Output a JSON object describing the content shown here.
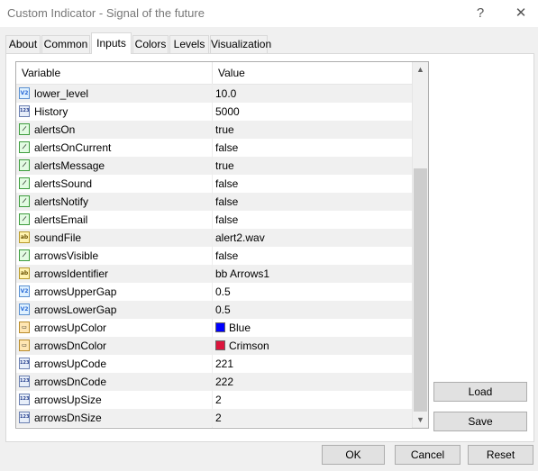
{
  "window": {
    "title": "Custom Indicator - Signal of the future",
    "help_glyph": "?",
    "close_glyph": "✕"
  },
  "tabs": [
    {
      "label": "About"
    },
    {
      "label": "Common"
    },
    {
      "label": "Inputs"
    },
    {
      "label": "Colors"
    },
    {
      "label": "Levels"
    },
    {
      "label": "Visualization"
    }
  ],
  "active_tab": "Inputs",
  "grid": {
    "columns": {
      "variable": "Variable",
      "value": "Value"
    },
    "rows": [
      {
        "type": "double",
        "name": "lower_level",
        "value": "10.0"
      },
      {
        "type": "int",
        "name": "History",
        "value": "5000"
      },
      {
        "type": "bool",
        "name": "alertsOn",
        "value": "true"
      },
      {
        "type": "bool",
        "name": "alertsOnCurrent",
        "value": "false"
      },
      {
        "type": "bool",
        "name": "alertsMessage",
        "value": "true"
      },
      {
        "type": "bool",
        "name": "alertsSound",
        "value": "false"
      },
      {
        "type": "bool",
        "name": "alertsNotify",
        "value": "false"
      },
      {
        "type": "bool",
        "name": "alertsEmail",
        "value": "false"
      },
      {
        "type": "string",
        "name": "soundFile",
        "value": "alert2.wav"
      },
      {
        "type": "bool",
        "name": "arrowsVisible",
        "value": "false"
      },
      {
        "type": "string",
        "name": "arrowsIdentifier",
        "value": "bb Arrows1"
      },
      {
        "type": "double",
        "name": "arrowsUpperGap",
        "value": "0.5"
      },
      {
        "type": "double",
        "name": "arrowsLowerGap",
        "value": "0.5"
      },
      {
        "type": "color",
        "name": "arrowsUpColor",
        "value": "Blue",
        "swatch": "#0000ff"
      },
      {
        "type": "color",
        "name": "arrowsDnColor",
        "value": "Crimson",
        "swatch": "#dc143c"
      },
      {
        "type": "int",
        "name": "arrowsUpCode",
        "value": "221"
      },
      {
        "type": "int",
        "name": "arrowsDnCode",
        "value": "222"
      },
      {
        "type": "int",
        "name": "arrowsUpSize",
        "value": "2"
      },
      {
        "type": "int",
        "name": "arrowsDnSize",
        "value": "2"
      }
    ],
    "scroll_up_glyph": "▲",
    "scroll_down_glyph": "▼"
  },
  "side_buttons": {
    "load": "Load",
    "save": "Save"
  },
  "footer_buttons": {
    "ok": "OK",
    "cancel": "Cancel",
    "reset": "Reset"
  }
}
